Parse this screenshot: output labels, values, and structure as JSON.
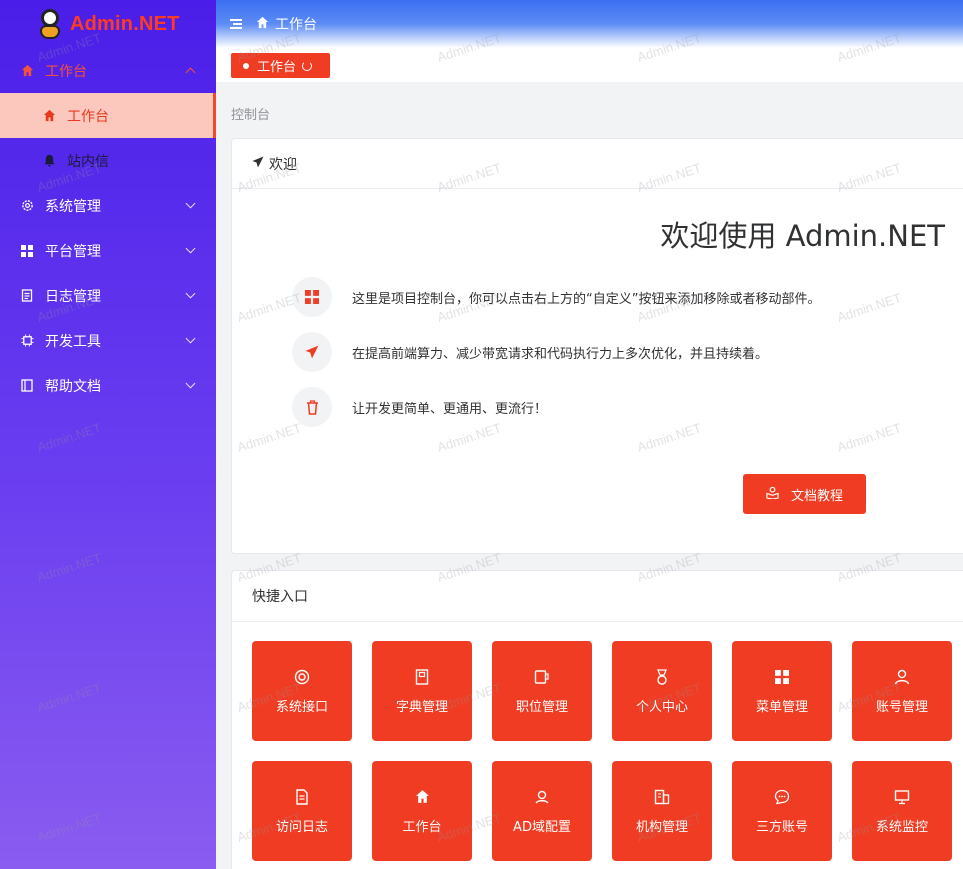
{
  "app": {
    "title": "Admin.NET",
    "watermark": "Admin.NET"
  },
  "sidebar": {
    "items": [
      {
        "label": "工作台",
        "icon": "home-icon",
        "open": true,
        "children": [
          {
            "label": "工作台",
            "icon": "home-icon",
            "active": true
          },
          {
            "label": "站内信",
            "icon": "bell-icon",
            "active": false
          }
        ]
      },
      {
        "label": "系统管理",
        "icon": "gear-icon"
      },
      {
        "label": "平台管理",
        "icon": "grid-icon"
      },
      {
        "label": "日志管理",
        "icon": "document-icon"
      },
      {
        "label": "开发工具",
        "icon": "chip-icon"
      },
      {
        "label": "帮助文档",
        "icon": "book-icon"
      }
    ]
  },
  "header": {
    "breadcrumb": "工作台"
  },
  "tags": [
    {
      "label": "工作台",
      "active": true
    }
  ],
  "page": {
    "section_title": "控制台"
  },
  "welcome_card": {
    "header": "欢迎",
    "title": "欢迎使用 Admin.NET",
    "tips": [
      {
        "icon": "grid-icon",
        "text": "这里是项目控制台，你可以点击右上方的“自定义”按钮来添加移除或者移动部件。"
      },
      {
        "icon": "send-icon",
        "text": "在提高前端算力、减少带宽请求和代码执行力上多次优化，并且持续着。"
      },
      {
        "icon": "trash-icon",
        "text": "让开发更简单、更通用、更流行！"
      }
    ],
    "button_label": "文档教程"
  },
  "shortcuts": {
    "header": "快捷入口",
    "tiles": [
      {
        "label": "系统接口",
        "icon": "lifebuoy-icon"
      },
      {
        "label": "字典管理",
        "icon": "notebook-icon"
      },
      {
        "label": "职位管理",
        "icon": "cup-icon"
      },
      {
        "label": "个人中心",
        "icon": "medal-icon"
      },
      {
        "label": "菜单管理",
        "icon": "grid-icon"
      },
      {
        "label": "账号管理",
        "icon": "user-icon"
      },
      {
        "label": "访问日志",
        "icon": "document-icon"
      },
      {
        "label": "工作台",
        "icon": "home-icon"
      },
      {
        "label": "AD域配置",
        "icon": "location-icon"
      },
      {
        "label": "机构管理",
        "icon": "office-building-icon"
      },
      {
        "label": "三方账号",
        "icon": "chat-icon"
      },
      {
        "label": "系统监控",
        "icon": "monitor-icon"
      }
    ]
  },
  "colors": {
    "accent": "#f03c22",
    "sidebar_top": "#4a1ee8",
    "sidebar_bottom": "#8a5cf0",
    "header": "#3b6ff2"
  }
}
